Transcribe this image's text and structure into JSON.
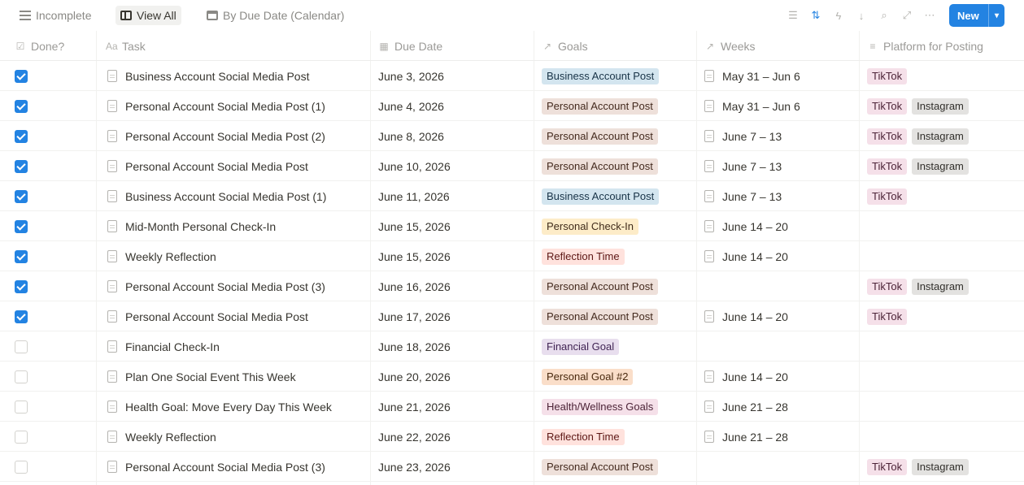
{
  "views": [
    {
      "label": "Incomplete",
      "icon": "list-icon",
      "active": false
    },
    {
      "label": "View All",
      "icon": "table-icon",
      "active": true
    },
    {
      "label": "By Due Date (Calendar)",
      "icon": "calendar-icon",
      "active": false
    }
  ],
  "toolbar": {
    "icons": [
      "filter-icon",
      "sort-icon",
      "lightning-icon",
      "arrow-down-icon",
      "search-icon",
      "link-icon",
      "expand-icon"
    ],
    "new_label": "New",
    "new_chevron": "▾"
  },
  "columns": {
    "done": "Done?",
    "task": "Task",
    "due": "Due Date",
    "goals": "Goals",
    "weeks": "Weeks",
    "platform": "Platform for Posting"
  },
  "colors": {
    "accent": "#2383e2"
  },
  "rows": [
    {
      "done": true,
      "task": "Business Account Social Media Post",
      "due": "June 3, 2026",
      "goal": "Business Account Post",
      "goal_style": "business",
      "week": "May 31 – Jun 6",
      "platforms": [
        "TikTok"
      ]
    },
    {
      "done": true,
      "task": "Personal Account Social Media Post (1)",
      "due": "June 4, 2026",
      "goal": "Personal Account Post",
      "goal_style": "personal",
      "week": "May 31 – Jun 6",
      "platforms": [
        "TikTok",
        "Instagram"
      ]
    },
    {
      "done": true,
      "task": "Personal Account Social Media Post (2)",
      "due": "June 8, 2026",
      "goal": "Personal Account Post",
      "goal_style": "personal",
      "week": "June 7 – 13",
      "platforms": [
        "TikTok",
        "Instagram"
      ]
    },
    {
      "done": true,
      "task": "Personal Account Social Media Post",
      "due": "June 10, 2026",
      "goal": "Personal Account Post",
      "goal_style": "personal",
      "week": "June 7 – 13",
      "platforms": [
        "TikTok",
        "Instagram"
      ]
    },
    {
      "done": true,
      "task": "Business Account Social Media Post (1)",
      "due": "June 11, 2026",
      "goal": "Business Account Post",
      "goal_style": "business",
      "week": "June 7 – 13",
      "platforms": [
        "TikTok"
      ]
    },
    {
      "done": true,
      "task": "Mid-Month Personal Check-In",
      "due": "June 15, 2026",
      "goal": "Personal Check-In",
      "goal_style": "checkin",
      "week": "June 14 – 20",
      "platforms": []
    },
    {
      "done": true,
      "task": "Weekly Reflection",
      "due": "June 15, 2026",
      "goal": "Reflection Time",
      "goal_style": "reflect",
      "week": "June 14 – 20",
      "platforms": []
    },
    {
      "done": true,
      "task": "Personal Account Social Media Post (3)",
      "due": "June 16, 2026",
      "goal": "Personal Account Post",
      "goal_style": "personal",
      "week": "",
      "platforms": [
        "TikTok",
        "Instagram"
      ]
    },
    {
      "done": true,
      "task": "Personal Account Social Media Post",
      "due": "June 17, 2026",
      "goal": "Personal Account Post",
      "goal_style": "personal",
      "week": "June 14 – 20",
      "platforms": [
        "TikTok"
      ]
    },
    {
      "done": false,
      "task": "Financial Check-In",
      "due": "June 18, 2026",
      "goal": "Financial Goal",
      "goal_style": "financial",
      "week": "",
      "platforms": []
    },
    {
      "done": false,
      "task": "Plan One Social Event This Week",
      "due": "June 20, 2026",
      "goal": "Personal Goal #2",
      "goal_style": "social",
      "week": "June 14 – 20",
      "platforms": []
    },
    {
      "done": false,
      "task": "Health Goal: Move Every Day This Week",
      "due": "June 21, 2026",
      "goal": "Health/Wellness Goals",
      "goal_style": "health",
      "week": "June 21 – 28",
      "platforms": []
    },
    {
      "done": false,
      "task": "Weekly Reflection",
      "due": "June 22, 2026",
      "goal": "Reflection Time",
      "goal_style": "reflect",
      "week": "June 21 – 28",
      "platforms": []
    },
    {
      "done": false,
      "task": "Personal Account Social Media Post (3)",
      "due": "June 23, 2026",
      "goal": "Personal Account Post",
      "goal_style": "personal",
      "week": "",
      "platforms": [
        "TikTok",
        "Instagram"
      ]
    }
  ]
}
